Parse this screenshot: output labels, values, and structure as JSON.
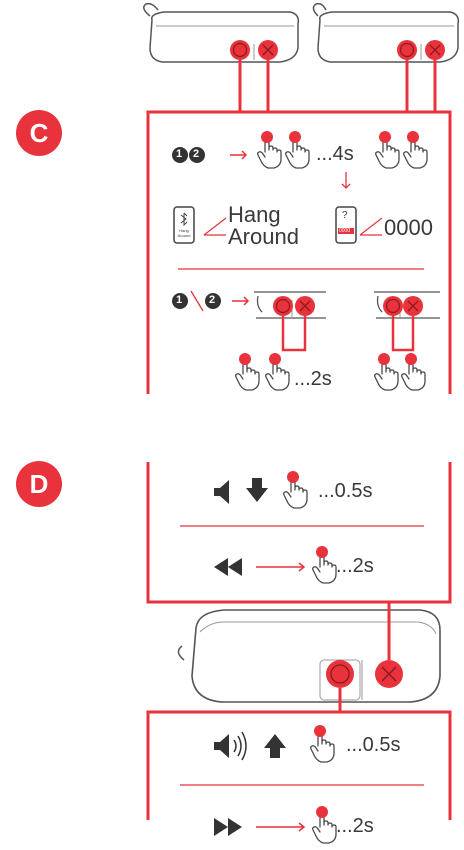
{
  "sections": {
    "c": {
      "badge": "C",
      "pair_wait": "...4s",
      "device_name_line1": "Hang",
      "device_name_line2": "Around",
      "pin_code": "0000",
      "phone_screen_label_line1": "Hang",
      "phone_screen_label_line2": "Around",
      "phone_question": "?",
      "phone_pin_small": "0000",
      "step_one": "1",
      "step_two": "2",
      "hold_time": "...2s"
    },
    "d": {
      "badge": "D",
      "volume_down_time": "...0.5s",
      "previous_track_time": "...2s",
      "volume_up_time": "...0.5s",
      "next_track_time": "...2s"
    }
  },
  "colors": {
    "accent": "#e8333c",
    "outline": "#555555",
    "icon_dark": "#333333"
  },
  "icons": [
    "speaker-icon",
    "tap-hand-icon",
    "bluetooth-icon",
    "phone-icon",
    "volume-down-icon",
    "volume-up-icon",
    "arrow-down-icon",
    "arrow-up-icon",
    "previous-track-icon",
    "next-track-icon",
    "arrow-right-icon"
  ]
}
